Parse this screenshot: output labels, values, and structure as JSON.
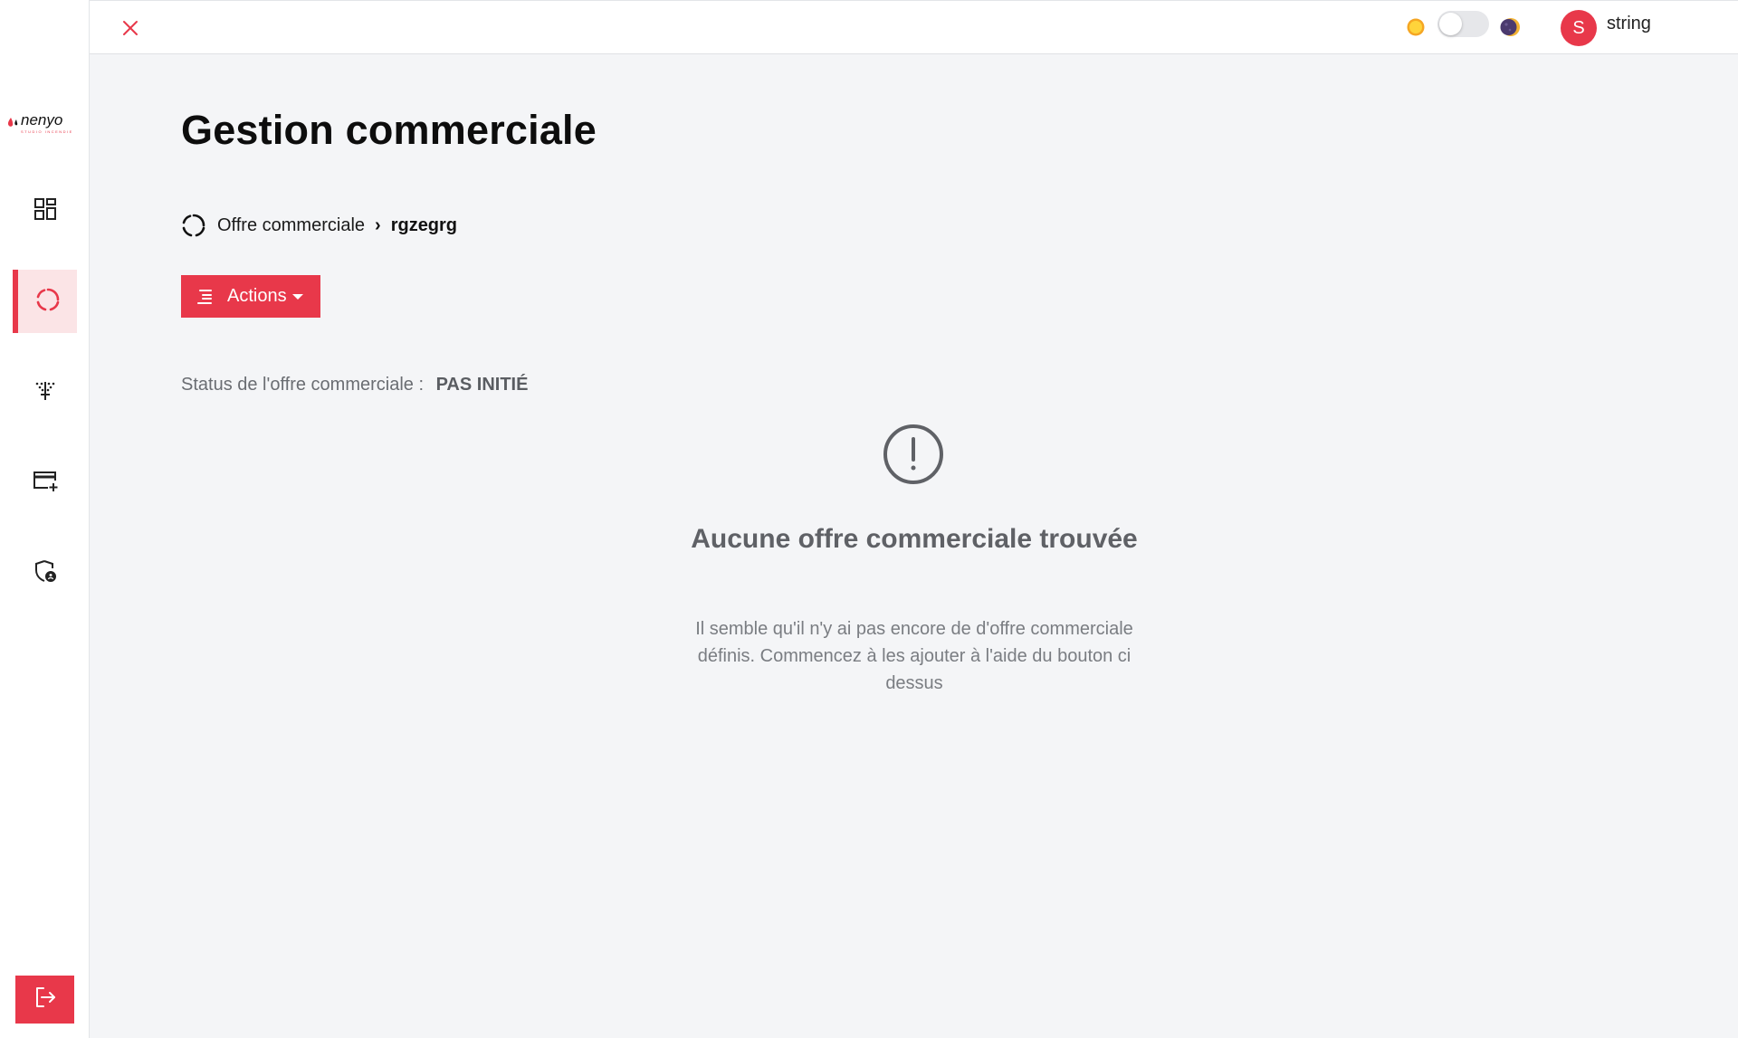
{
  "brand": {
    "logo_text": "nenyo",
    "logo_tagline": "STUDIO INCENDIE"
  },
  "colors": {
    "accent": "#e8384a",
    "active_bg": "#fbe4e6"
  },
  "sidebar": {
    "items": [
      {
        "icon": "dashboard-grid-icon",
        "active": false
      },
      {
        "icon": "circular-progress-icon",
        "active": true
      },
      {
        "icon": "filter-funnel-icon",
        "active": false
      },
      {
        "icon": "add-card-icon",
        "active": false
      },
      {
        "icon": "shield-user-icon",
        "active": false
      }
    ],
    "logout_icon": "logout-icon"
  },
  "topbar": {
    "close_icon": "close-icon",
    "theme_light_icon": "sun-icon",
    "theme_dark_icon": "moon-icon",
    "theme_toggle_on": false,
    "user": {
      "initial": "S",
      "name": "string"
    }
  },
  "main": {
    "title": "Gestion commerciale",
    "breadcrumb": {
      "parent": "Offre commerciale",
      "separator": "›",
      "current": "rgzegrg"
    },
    "actions_label": "Actions",
    "status_label": "Status de l'offre commerciale :",
    "status_value": "PAS INITIÉ",
    "empty_state": {
      "icon": "alert-circle-icon",
      "title": "Aucune offre commerciale trouvée",
      "description": "Il semble qu'il n'y ai pas encore de d'offre commerciale définis. Commencez à les ajouter à l'aide du bouton ci dessus"
    }
  }
}
